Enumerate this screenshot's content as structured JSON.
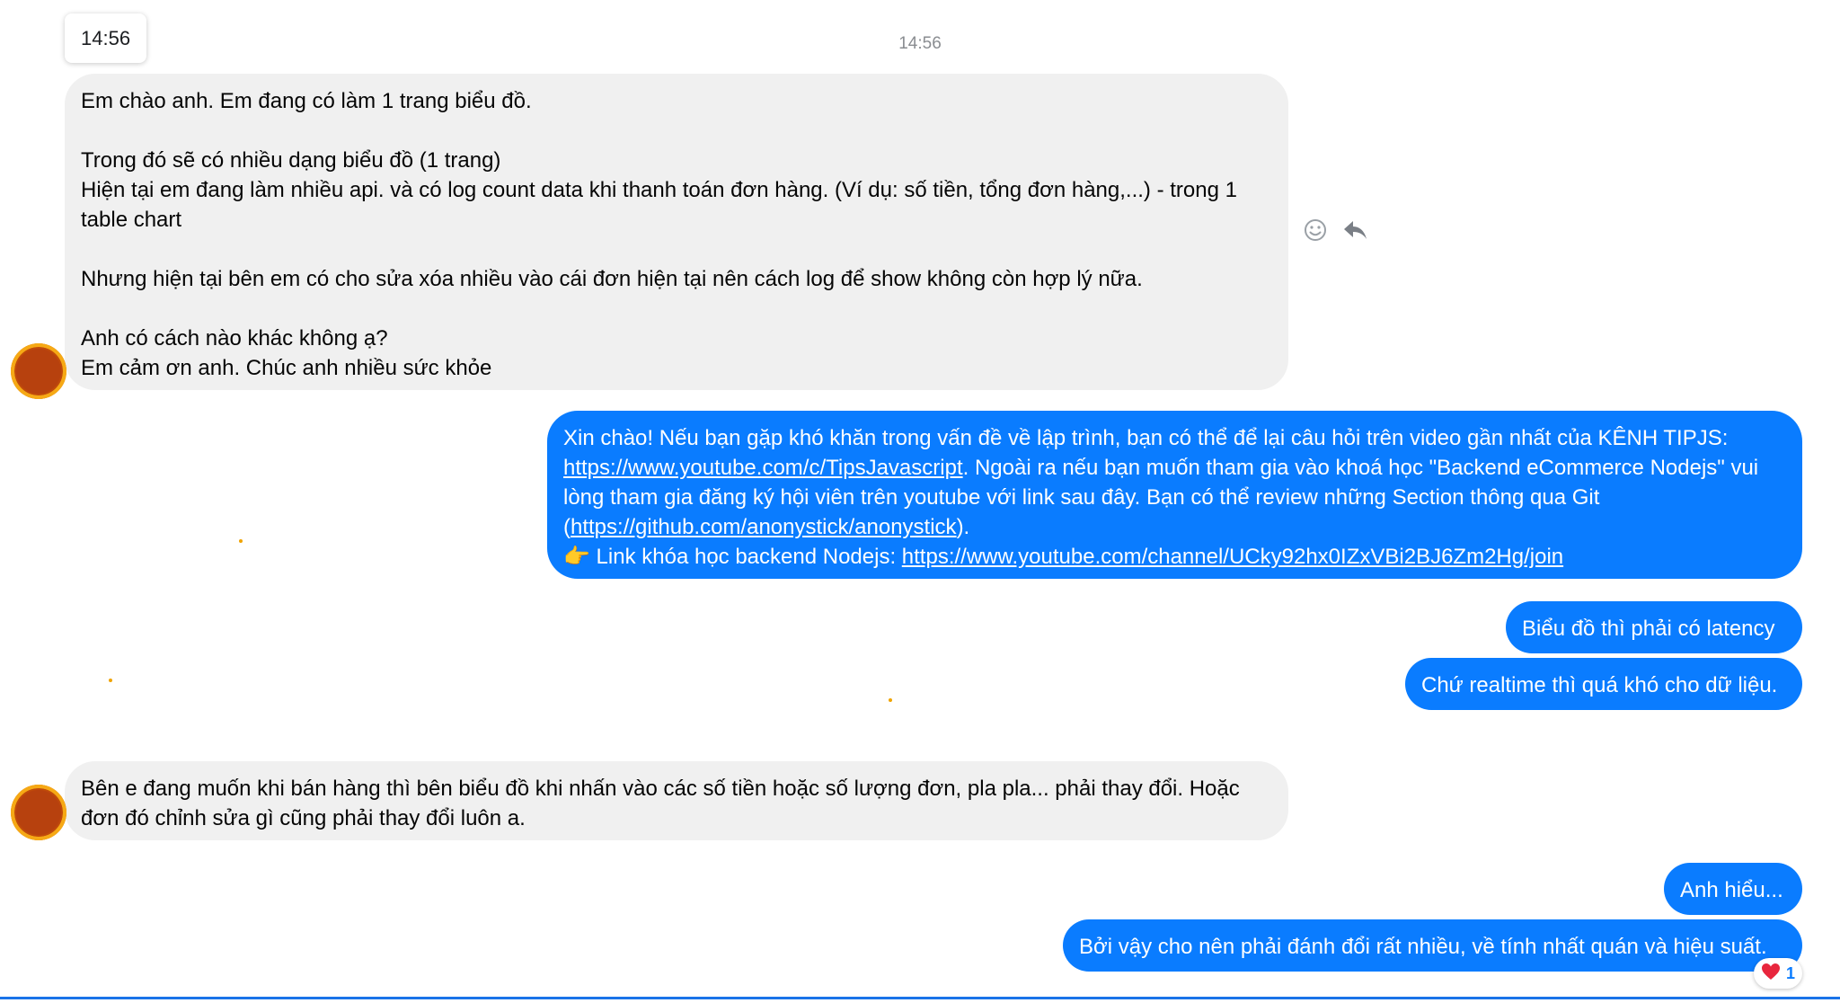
{
  "tooltip_time": "14:56",
  "divider_time": "14:56",
  "messages": {
    "m1": "Em chào anh. Em đang có làm 1 trang biểu đồ.\n\nTrong đó sẽ có nhiều dạng biểu đồ (1 trang)\nHiện tại em đang làm nhiều api. và có log count data khi thanh toán đơn hàng. (Ví dụ: số tiền, tổng đơn hàng,...) - trong 1 table chart\n\nNhưng hiện tại bên em có cho sửa xóa nhiều vào cái đơn hiện tại nên cách log để show không còn hợp lý nữa.\n\nAnh có cách nào khác không ạ?\nEm cảm ơn anh. Chúc anh nhiều sức khỏe",
    "m2": {
      "part1": "Xin chào! Nếu bạn gặp khó khăn trong vấn đề về lập trình, bạn có thể để lại câu hỏi trên video gần nhất của KÊNH TIPJS: ",
      "link1": "https://www.youtube.com/c/TipsJavascript",
      "part2": ". Ngoài ra nếu bạn muốn tham gia vào khoá học \"Backend eCommerce Nodejs\" vui lòng tham gia đăng ký hội viên trên youtube với link sau đây. Bạn có thể review những Section thông qua Git (",
      "link2": "https://github.com/anonystick/anonystick",
      "part3": ").\n",
      "emoji": "👉",
      "part4": " Link khóa học backend Nodejs: ",
      "link3": "https://www.youtube.com/channel/UCky92hx0IZxVBi2BJ6Zm2Hg/join"
    },
    "m3": "Biểu đồ thì phải có latency",
    "m4": "Chứ realtime thì quá khó cho dữ liệu.",
    "m5": "Bên e đang muốn khi bán hàng thì bên biểu đồ khi nhấn vào các số tiền hoặc số lượng đơn, pla pla... phải thay đổi. Hoặc đơn đó chỉnh sửa gì cũng phải thay đổi luôn a.",
    "m6": "Anh hiểu...",
    "m7": "Bởi vậy cho nên phải đánh đổi rất nhiều, về tính nhất quán và hiệu suất."
  },
  "reaction": {
    "icon": "heart-icon",
    "count": "1"
  },
  "icons": {
    "react": "smiley-icon",
    "reply": "reply-arrow-icon"
  },
  "colors": {
    "outgoing": "#0a7cff",
    "incoming": "#f0f0f0",
    "avatar": "#c04a0a",
    "avatar_ring": "#f6a915"
  }
}
